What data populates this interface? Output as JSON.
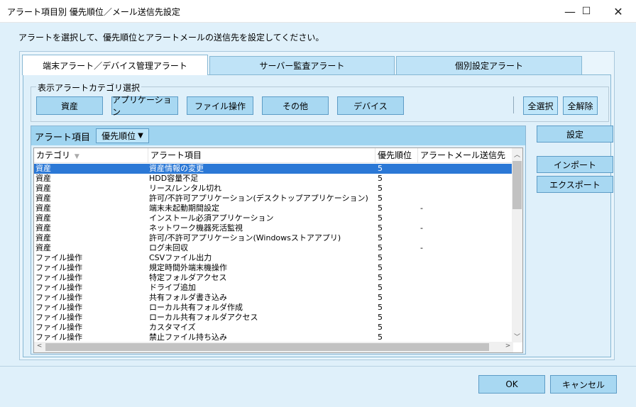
{
  "window": {
    "title": "アラート項目別 優先順位／メール送信先設定",
    "minimize_glyph": "—",
    "maximize_glyph": "☐",
    "close_glyph": "✕"
  },
  "instruction": "アラートを選択して、優先順位とアラートメールの送信先を設定してください。",
  "tabs": [
    {
      "label": "端末アラート／デバイス管理アラート",
      "active": true
    },
    {
      "label": "サーバー監査アラート",
      "active": false
    },
    {
      "label": "個別設定アラート",
      "active": false
    }
  ],
  "category_group": {
    "legend": "表示アラートカテゴリ選択",
    "buttons": [
      "資産",
      "アプリケーション",
      "ファイル操作",
      "その他",
      "デバイス"
    ],
    "select_all": "全選択",
    "clear_all": "全解除"
  },
  "list": {
    "title": "アラート項目",
    "sort_button": "優先順位",
    "sort_icon": "▼",
    "columns": [
      "カテゴリ",
      "アラート項目",
      "優先順位",
      "アラートメール送信先"
    ],
    "sort_indicator": "▼",
    "rows": [
      {
        "category": "資産",
        "item": "資産情報の変更",
        "priority": "5",
        "mail": "",
        "selected": true
      },
      {
        "category": "資産",
        "item": "HDD容量不足",
        "priority": "5",
        "mail": ""
      },
      {
        "category": "資産",
        "item": "リース/レンタル切れ",
        "priority": "5",
        "mail": ""
      },
      {
        "category": "資産",
        "item": "許可/不許可アプリケーション(デスクトップアプリケーション)",
        "priority": "5",
        "mail": ""
      },
      {
        "category": "資産",
        "item": "端末未起動期間設定",
        "priority": "5",
        "mail": "-"
      },
      {
        "category": "資産",
        "item": "インストール必須アプリケーション",
        "priority": "5",
        "mail": ""
      },
      {
        "category": "資産",
        "item": "ネットワーク機器死活監視",
        "priority": "5",
        "mail": "-"
      },
      {
        "category": "資産",
        "item": "許可/不許可アプリケーション(Windowsストアアプリ)",
        "priority": "5",
        "mail": ""
      },
      {
        "category": "資産",
        "item": "ログ未回収",
        "priority": "5",
        "mail": "-"
      },
      {
        "category": "ファイル操作",
        "item": "CSVファイル出力",
        "priority": "5",
        "mail": ""
      },
      {
        "category": "ファイル操作",
        "item": "規定時間外端末機操作",
        "priority": "5",
        "mail": ""
      },
      {
        "category": "ファイル操作",
        "item": "特定フォルダアクセス",
        "priority": "5",
        "mail": ""
      },
      {
        "category": "ファイル操作",
        "item": "ドライブ追加",
        "priority": "5",
        "mail": ""
      },
      {
        "category": "ファイル操作",
        "item": "共有フォルダ書き込み",
        "priority": "5",
        "mail": ""
      },
      {
        "category": "ファイル操作",
        "item": "ローカル共有フォルダ作成",
        "priority": "5",
        "mail": ""
      },
      {
        "category": "ファイル操作",
        "item": "ローカル共有フォルダアクセス",
        "priority": "5",
        "mail": ""
      },
      {
        "category": "ファイル操作",
        "item": "カスタマイズ",
        "priority": "5",
        "mail": ""
      },
      {
        "category": "ファイル操作",
        "item": "禁止ファイル持ち込み",
        "priority": "5",
        "mail": ""
      }
    ]
  },
  "side_buttons": {
    "settings": "設定",
    "import": "インポート",
    "export": "エクスポート"
  },
  "footer": {
    "ok": "OK",
    "cancel": "キャンセル"
  },
  "scroll": {
    "up": "︿",
    "down": "﹀",
    "left": "<",
    "right": ">"
  }
}
